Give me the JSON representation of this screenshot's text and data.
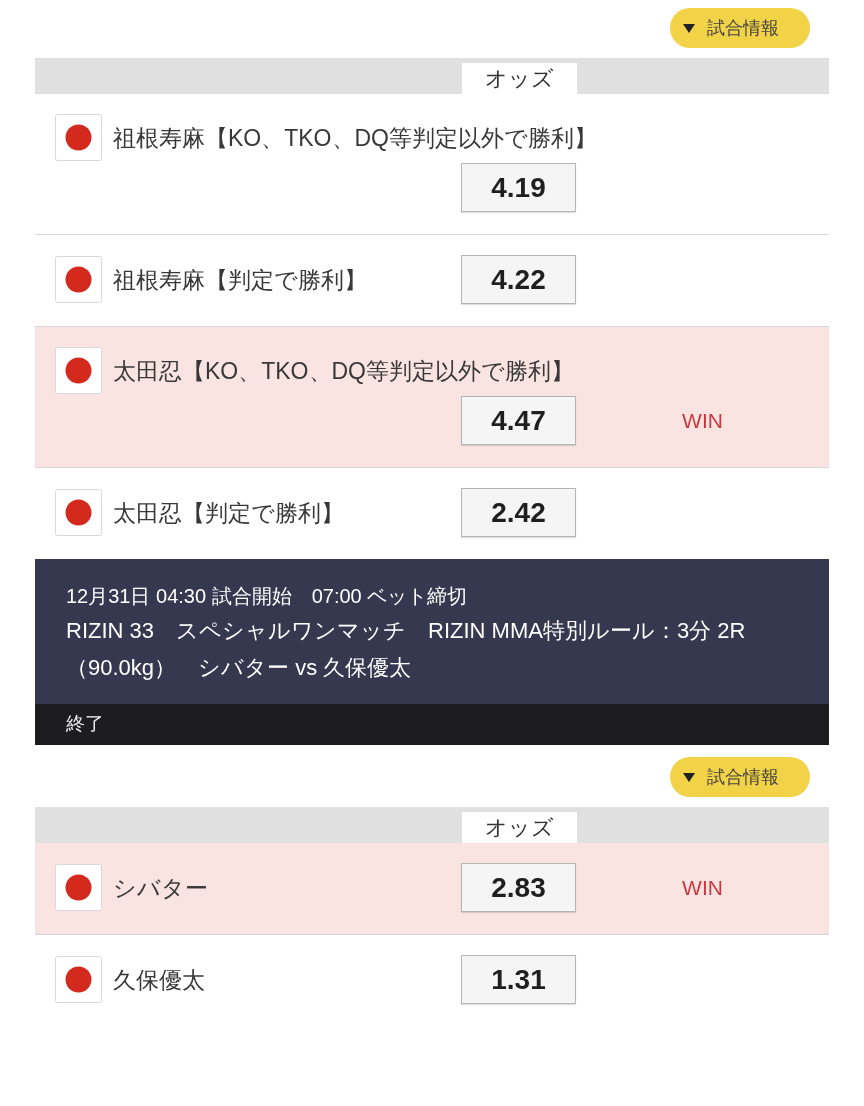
{
  "matches": [
    {
      "info_button": {
        "label": "試合情報"
      },
      "odds_header": "オッズ",
      "bets": [
        {
          "name": "祖根寿麻【KO、TKO、DQ等判定以外で勝利】",
          "odds": "4.19",
          "won": false
        },
        {
          "name": "祖根寿麻【判定で勝利】",
          "odds": "4.22",
          "won": false
        },
        {
          "name": "太田忍【KO、TKO、DQ等判定以外で勝利】",
          "odds": "4.47",
          "won": true,
          "result": "WIN"
        },
        {
          "name": "太田忍【判定で勝利】",
          "odds": "2.42",
          "won": false
        }
      ]
    },
    {
      "card": {
        "schedule": "12月31日 04:30 試合開始　07:00 ベット締切",
        "title_lines": [
          "RIZIN 33　スペシャルワンマッチ　RIZIN MMA特別ルール：3分 2R",
          "（90.0kg）　シバター vs 久保優太"
        ],
        "status": "終了"
      },
      "info_button": {
        "label": "試合情報"
      },
      "odds_header": "オッズ",
      "bets": [
        {
          "name": "シバター",
          "odds": "2.83",
          "won": true,
          "result": "WIN"
        },
        {
          "name": "久保優太",
          "odds": "1.31",
          "won": false
        }
      ]
    }
  ]
}
